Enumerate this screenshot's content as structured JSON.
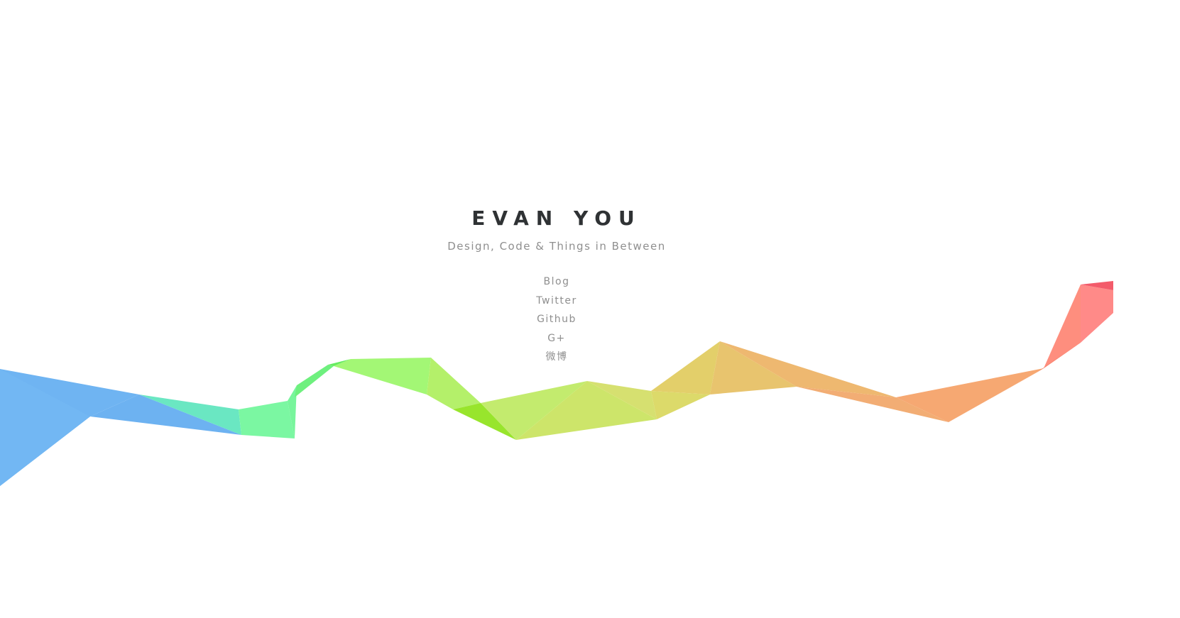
{
  "header": {
    "title": "EVAN YOU",
    "tagline": "Design, Code & Things in Between"
  },
  "nav": {
    "links": [
      {
        "label": "Blog"
      },
      {
        "label": "Twitter"
      },
      {
        "label": "Github"
      },
      {
        "label": "G+"
      },
      {
        "label": "微博"
      }
    ]
  },
  "colors": {
    "title": "#2f3234",
    "text_muted": "#8f8f8f",
    "ribbon_blue": "#6fb4f2",
    "ribbon_mint": "#7bf7a2",
    "ribbon_green": "#a3f775",
    "ribbon_yellow": "#e3cf6a",
    "ribbon_orange": "#f6a872",
    "ribbon_red": "#f35b6a"
  }
}
